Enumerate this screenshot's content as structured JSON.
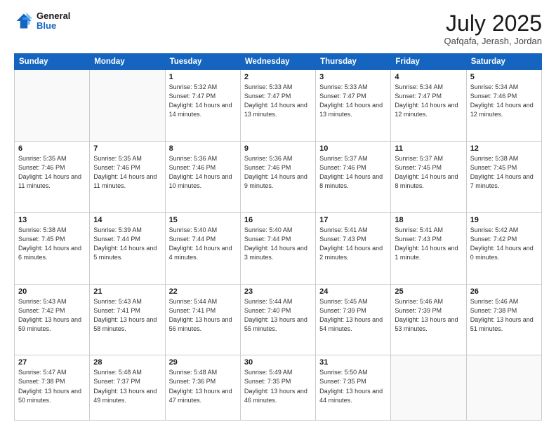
{
  "header": {
    "logo_general": "General",
    "logo_blue": "Blue",
    "month_title": "July 2025",
    "location": "Qafqafa, Jerash, Jordan"
  },
  "weekdays": [
    "Sunday",
    "Monday",
    "Tuesday",
    "Wednesday",
    "Thursday",
    "Friday",
    "Saturday"
  ],
  "weeks": [
    [
      {
        "day": "",
        "info": ""
      },
      {
        "day": "",
        "info": ""
      },
      {
        "day": "1",
        "info": "Sunrise: 5:32 AM\nSunset: 7:47 PM\nDaylight: 14 hours and 14 minutes."
      },
      {
        "day": "2",
        "info": "Sunrise: 5:33 AM\nSunset: 7:47 PM\nDaylight: 14 hours and 13 minutes."
      },
      {
        "day": "3",
        "info": "Sunrise: 5:33 AM\nSunset: 7:47 PM\nDaylight: 14 hours and 13 minutes."
      },
      {
        "day": "4",
        "info": "Sunrise: 5:34 AM\nSunset: 7:47 PM\nDaylight: 14 hours and 12 minutes."
      },
      {
        "day": "5",
        "info": "Sunrise: 5:34 AM\nSunset: 7:46 PM\nDaylight: 14 hours and 12 minutes."
      }
    ],
    [
      {
        "day": "6",
        "info": "Sunrise: 5:35 AM\nSunset: 7:46 PM\nDaylight: 14 hours and 11 minutes."
      },
      {
        "day": "7",
        "info": "Sunrise: 5:35 AM\nSunset: 7:46 PM\nDaylight: 14 hours and 11 minutes."
      },
      {
        "day": "8",
        "info": "Sunrise: 5:36 AM\nSunset: 7:46 PM\nDaylight: 14 hours and 10 minutes."
      },
      {
        "day": "9",
        "info": "Sunrise: 5:36 AM\nSunset: 7:46 PM\nDaylight: 14 hours and 9 minutes."
      },
      {
        "day": "10",
        "info": "Sunrise: 5:37 AM\nSunset: 7:46 PM\nDaylight: 14 hours and 8 minutes."
      },
      {
        "day": "11",
        "info": "Sunrise: 5:37 AM\nSunset: 7:45 PM\nDaylight: 14 hours and 8 minutes."
      },
      {
        "day": "12",
        "info": "Sunrise: 5:38 AM\nSunset: 7:45 PM\nDaylight: 14 hours and 7 minutes."
      }
    ],
    [
      {
        "day": "13",
        "info": "Sunrise: 5:38 AM\nSunset: 7:45 PM\nDaylight: 14 hours and 6 minutes."
      },
      {
        "day": "14",
        "info": "Sunrise: 5:39 AM\nSunset: 7:44 PM\nDaylight: 14 hours and 5 minutes."
      },
      {
        "day": "15",
        "info": "Sunrise: 5:40 AM\nSunset: 7:44 PM\nDaylight: 14 hours and 4 minutes."
      },
      {
        "day": "16",
        "info": "Sunrise: 5:40 AM\nSunset: 7:44 PM\nDaylight: 14 hours and 3 minutes."
      },
      {
        "day": "17",
        "info": "Sunrise: 5:41 AM\nSunset: 7:43 PM\nDaylight: 14 hours and 2 minutes."
      },
      {
        "day": "18",
        "info": "Sunrise: 5:41 AM\nSunset: 7:43 PM\nDaylight: 14 hours and 1 minute."
      },
      {
        "day": "19",
        "info": "Sunrise: 5:42 AM\nSunset: 7:42 PM\nDaylight: 14 hours and 0 minutes."
      }
    ],
    [
      {
        "day": "20",
        "info": "Sunrise: 5:43 AM\nSunset: 7:42 PM\nDaylight: 13 hours and 59 minutes."
      },
      {
        "day": "21",
        "info": "Sunrise: 5:43 AM\nSunset: 7:41 PM\nDaylight: 13 hours and 58 minutes."
      },
      {
        "day": "22",
        "info": "Sunrise: 5:44 AM\nSunset: 7:41 PM\nDaylight: 13 hours and 56 minutes."
      },
      {
        "day": "23",
        "info": "Sunrise: 5:44 AM\nSunset: 7:40 PM\nDaylight: 13 hours and 55 minutes."
      },
      {
        "day": "24",
        "info": "Sunrise: 5:45 AM\nSunset: 7:39 PM\nDaylight: 13 hours and 54 minutes."
      },
      {
        "day": "25",
        "info": "Sunrise: 5:46 AM\nSunset: 7:39 PM\nDaylight: 13 hours and 53 minutes."
      },
      {
        "day": "26",
        "info": "Sunrise: 5:46 AM\nSunset: 7:38 PM\nDaylight: 13 hours and 51 minutes."
      }
    ],
    [
      {
        "day": "27",
        "info": "Sunrise: 5:47 AM\nSunset: 7:38 PM\nDaylight: 13 hours and 50 minutes."
      },
      {
        "day": "28",
        "info": "Sunrise: 5:48 AM\nSunset: 7:37 PM\nDaylight: 13 hours and 49 minutes."
      },
      {
        "day": "29",
        "info": "Sunrise: 5:48 AM\nSunset: 7:36 PM\nDaylight: 13 hours and 47 minutes."
      },
      {
        "day": "30",
        "info": "Sunrise: 5:49 AM\nSunset: 7:35 PM\nDaylight: 13 hours and 46 minutes."
      },
      {
        "day": "31",
        "info": "Sunrise: 5:50 AM\nSunset: 7:35 PM\nDaylight: 13 hours and 44 minutes."
      },
      {
        "day": "",
        "info": ""
      },
      {
        "day": "",
        "info": ""
      }
    ]
  ]
}
